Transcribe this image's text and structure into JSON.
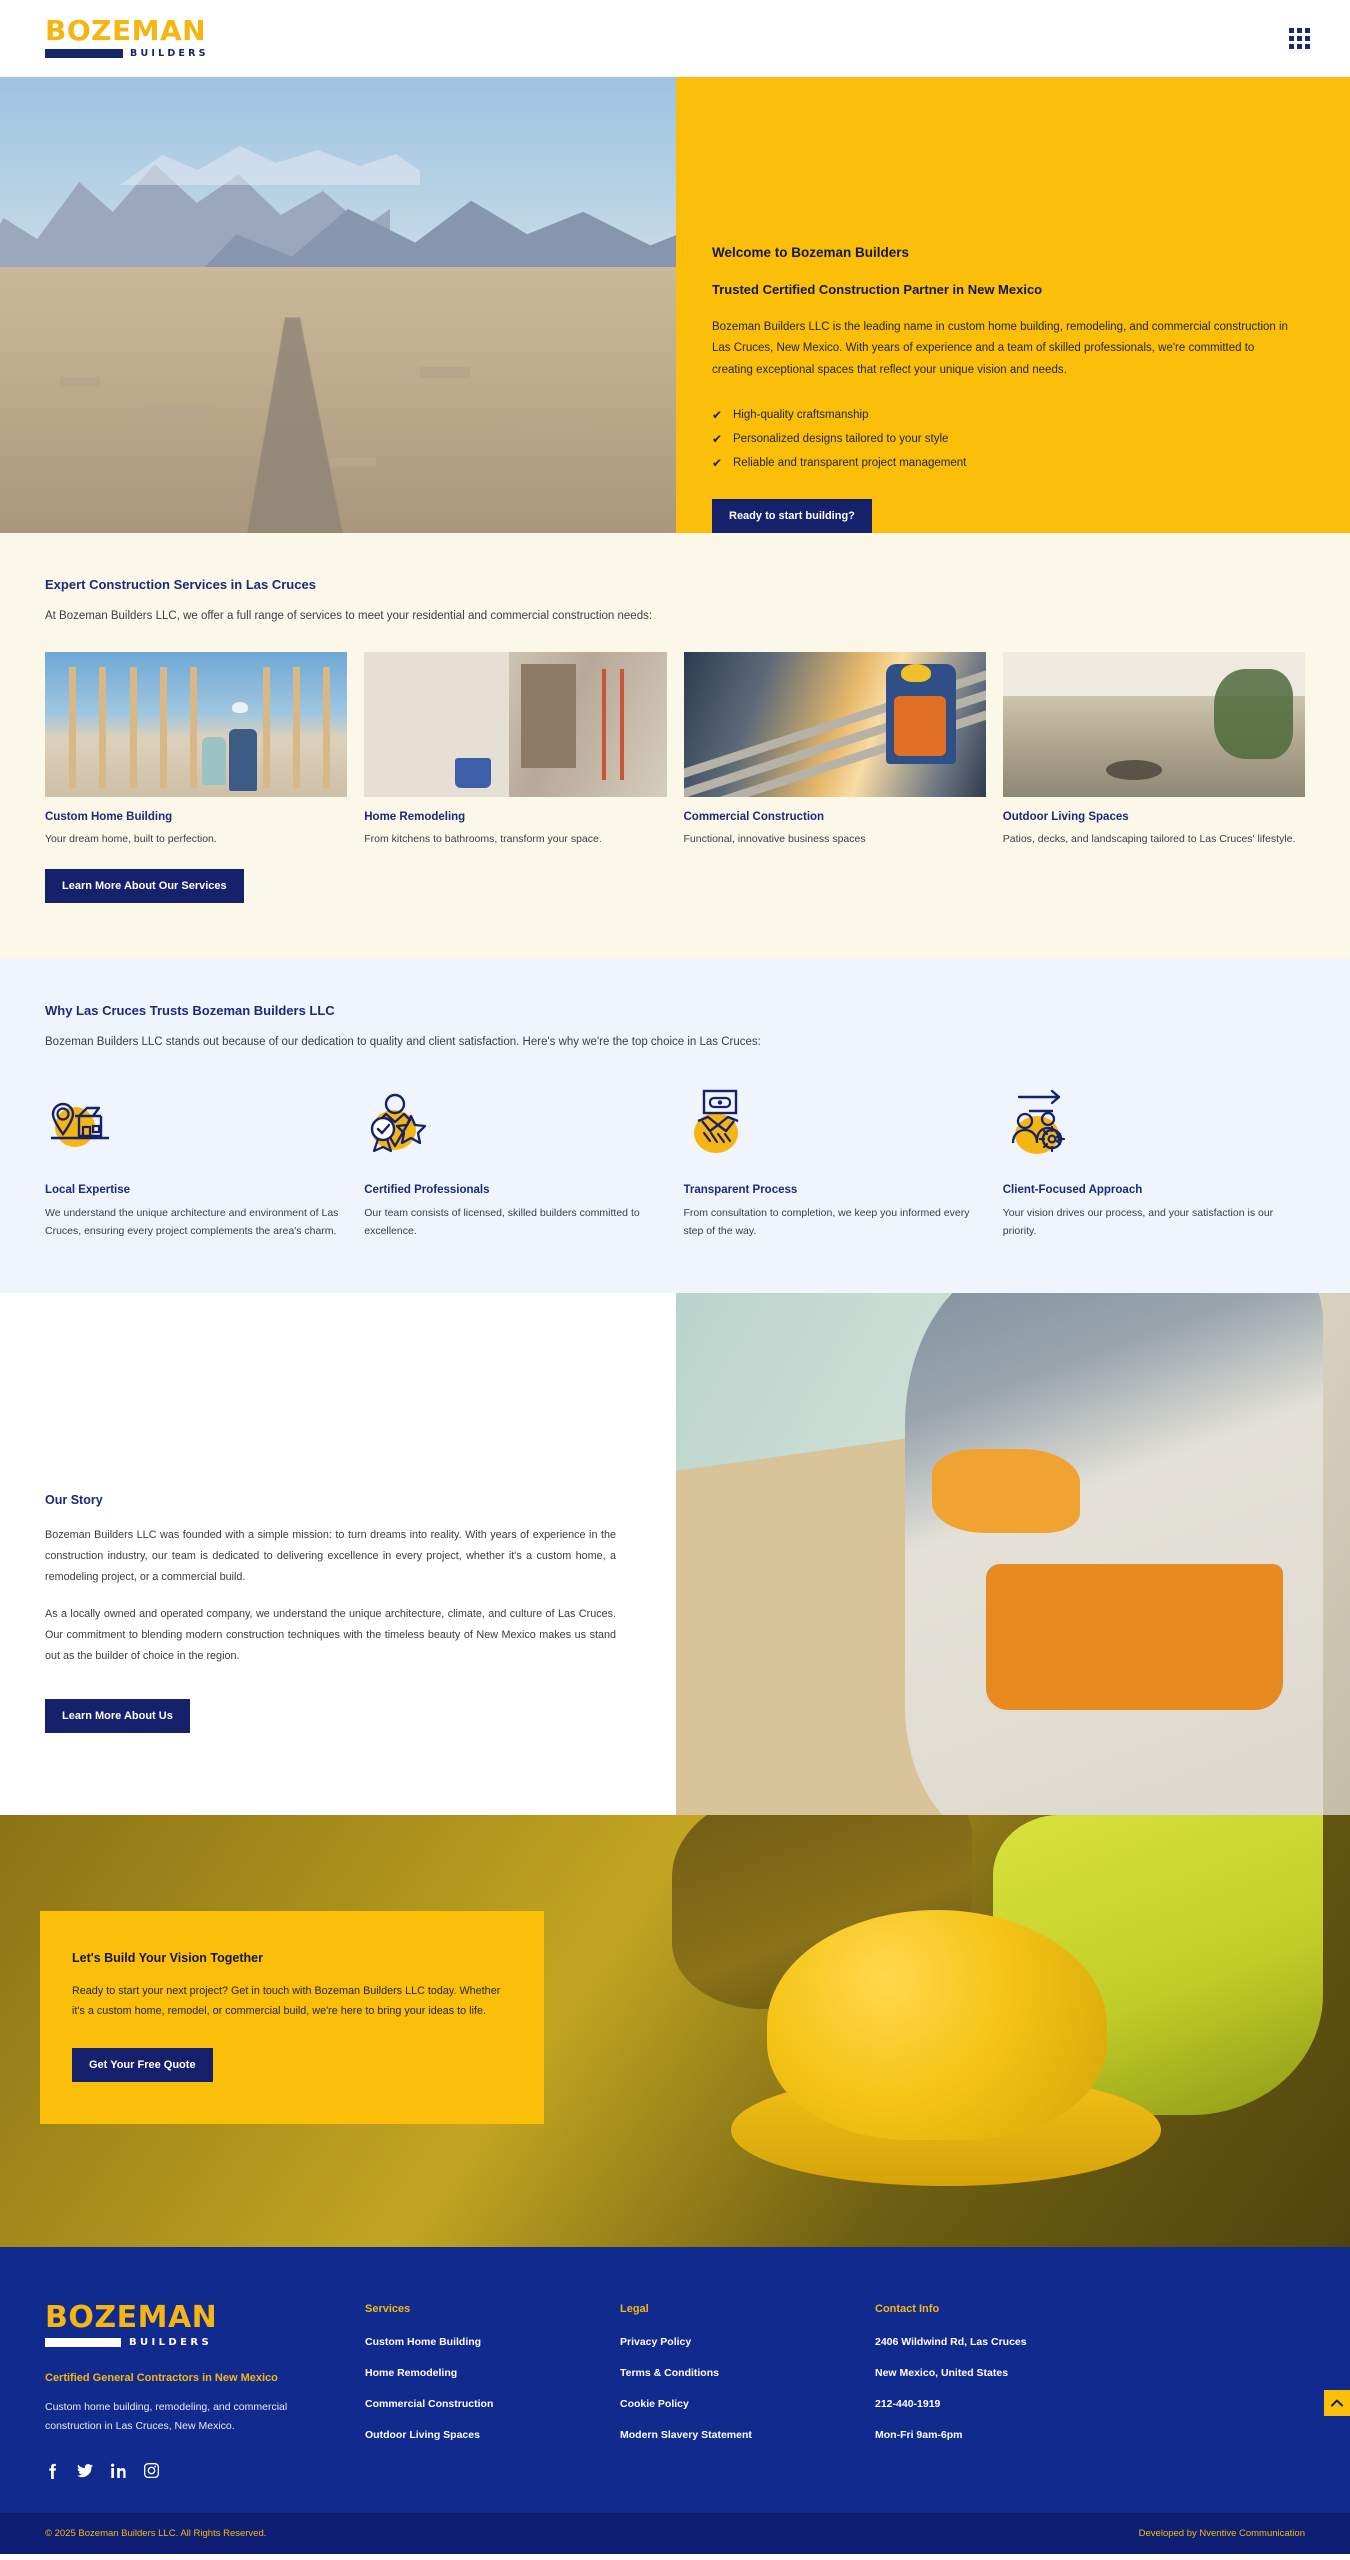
{
  "header": {
    "logo": {
      "word": "BOZEMAN",
      "sub": "BUILDERS"
    },
    "menu_icon": "grid-menu-icon"
  },
  "hero": {
    "welcome": "Welcome to Bozeman Builders",
    "subheading": "Trusted Certified Construction Partner in New Mexico",
    "paragraph": "Bozeman Builders LLC is the leading name in custom home building, remodeling, and commercial construction in Las Cruces, New Mexico. With years of experience and a team of skilled professionals, we're committed to creating exceptional spaces that reflect your unique vision and needs.",
    "bullets": [
      "High-quality craftsmanship",
      "Personalized designs tailored to your style",
      "Reliable and transparent project management"
    ],
    "cta_label": "Ready to start building?",
    "image_alt": "Aerial view of Las Cruces with Organ Mountains"
  },
  "services": {
    "title": "Expert Construction Services in Las Cruces",
    "lead": "At Bozeman Builders LLC, we offer a full range of services to meet your residential and commercial construction needs:",
    "cards": [
      {
        "title": "Custom Home Building",
        "desc": "Your dream home, built to perfection.",
        "image_alt": "Builders at a wood-framed house under construction"
      },
      {
        "title": "Home Remodeling",
        "desc": "From kitchens to bathrooms, transform your space.",
        "image_alt": "Interior remodeling with ladder and tools"
      },
      {
        "title": "Commercial Construction",
        "desc": "Functional, innovative business spaces",
        "image_alt": "Worker cutting steel beams at sunrise"
      },
      {
        "title": "Outdoor Living Spaces",
        "desc": "Patios, decks, and landscaping tailored to Las Cruces' lifestyle.",
        "image_alt": "Covered patio with fire pit and seating"
      }
    ],
    "cta_label": "Learn More About Our Services"
  },
  "why": {
    "title": "Why Las Cruces Trusts Bozeman Builders LLC",
    "lead": "Bozeman Builders LLC stands out because of our dedication to quality and client satisfaction. Here's why we're the top choice in Las Cruces:",
    "items": [
      {
        "icon": "location-pin-house-icon",
        "title": "Local Expertise",
        "desc": "We understand the unique architecture and environment of Las Cruces, ensuring every project complements the area's charm."
      },
      {
        "icon": "award-badge-star-icon",
        "title": "Certified Professionals",
        "desc": "Our team consists of licensed, skilled builders committed to excellence."
      },
      {
        "icon": "handshake-screen-icon",
        "title": "Transparent Process",
        "desc": "From consultation to completion, we keep you informed every step of the way."
      },
      {
        "icon": "people-gear-arrow-icon",
        "title": "Client-Focused Approach",
        "desc": "Your vision drives our process, and your satisfaction is our priority."
      }
    ]
  },
  "story": {
    "title": "Our Story",
    "paragraph1": "Bozeman Builders LLC was founded with a simple mission: to turn dreams into reality. With years of experience in the construction industry, our team is dedicated to delivering excellence in every project, whether it's a custom home, a remodeling project, or a commercial build.",
    "paragraph2": "As a locally owned and operated company, we understand the unique architecture, climate, and culture of Las Cruces. Our commitment to blending modern construction techniques with the timeless beauty of New Mexico makes us stand out as the builder of choice in the region.",
    "cta_label": "Learn More About Us",
    "image_alt": "Worker with tool belt installing drywall panel"
  },
  "cta": {
    "title": "Let's Build Your Vision Together",
    "paragraph": "Ready to start your next project? Get in touch with Bozeman Builders LLC today. Whether it's a custom home, remodel, or commercial build, we're here to bring your ideas to life.",
    "button_label": "Get Your Free Quote",
    "image_alt": "Gloved hand holding a yellow hard hat"
  },
  "footer": {
    "logo": {
      "word": "BOZEMAN",
      "sub": "BUILDERS"
    },
    "tagline": "Certified General Contractors in New Mexico",
    "description": "Custom home building, remodeling, and commercial construction in Las Cruces, New Mexico.",
    "socials": [
      "facebook-icon",
      "twitter-icon",
      "linkedin-icon",
      "instagram-icon"
    ],
    "services": {
      "heading": "Services",
      "links": [
        "Custom Home Building",
        "Home Remodeling",
        "Commercial Construction",
        "Outdoor Living Spaces"
      ]
    },
    "legal": {
      "heading": "Legal",
      "links": [
        "Privacy Policy",
        "Terms & Conditions",
        "Cookie Policy",
        "Modern Slavery Statement"
      ]
    },
    "contact": {
      "heading": "Contact Info",
      "items": [
        "2406 Wildwind Rd, Las Cruces",
        "New Mexico, United States",
        "212-440-1919",
        "Mon-Fri 9am-6pm"
      ]
    },
    "copyright": "© 2025 Bozeman Builders LLC. All Rights Reserved.",
    "developer": "Developed by Nventive Communication",
    "scroll_top_icon": "chevron-up-icon"
  },
  "colors": {
    "brand_yellow": "#FBBF0A",
    "logo_gold": "#F5B614",
    "brand_navy": "#16216b",
    "footer_navy": "#112A8E",
    "bottom_navy": "#0E1F73",
    "services_bg": "#FCF8E9",
    "why_bg": "#F0F4FD"
  }
}
